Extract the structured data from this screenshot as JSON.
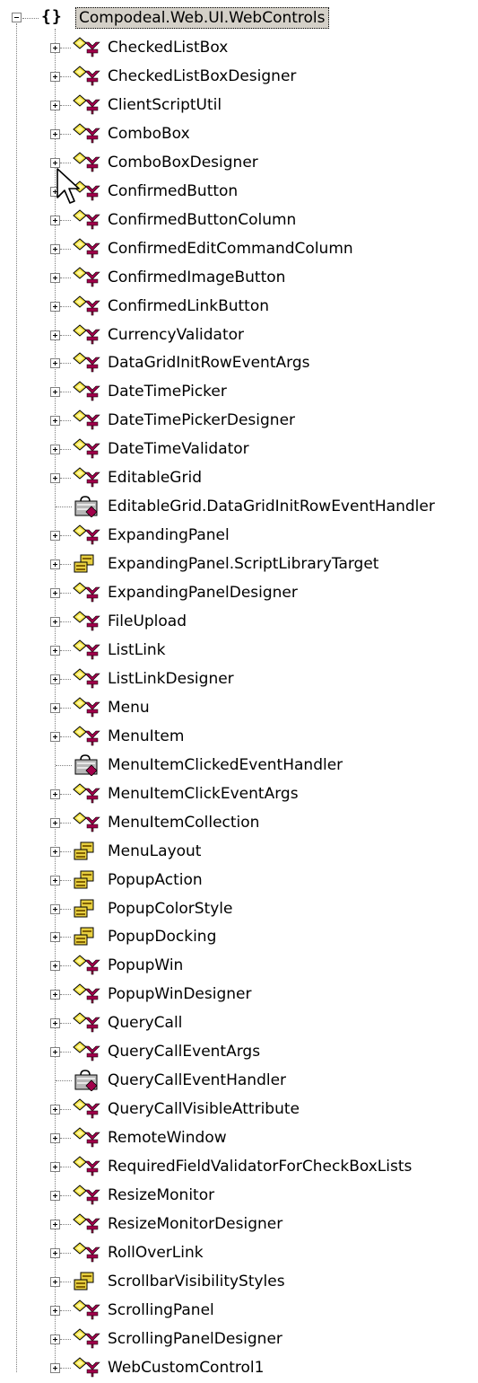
{
  "root": {
    "label": "Compodeal.Web.UI.WebControls",
    "icon": "namespace-icon",
    "glyph": "{}",
    "expanded": true
  },
  "items": [
    {
      "label": "CheckedListBox",
      "kind": "class"
    },
    {
      "label": "CheckedListBoxDesigner",
      "kind": "class"
    },
    {
      "label": "ClientScriptUtil",
      "kind": "class"
    },
    {
      "label": "ComboBox",
      "kind": "class"
    },
    {
      "label": "ComboBoxDesigner",
      "kind": "class"
    },
    {
      "label": "ConfirmedButton",
      "kind": "class"
    },
    {
      "label": "ConfirmedButtonColumn",
      "kind": "class"
    },
    {
      "label": "ConfirmedEditCommandColumn",
      "kind": "class"
    },
    {
      "label": "ConfirmedImageButton",
      "kind": "class"
    },
    {
      "label": "ConfirmedLinkButton",
      "kind": "class"
    },
    {
      "label": "CurrencyValidator",
      "kind": "class"
    },
    {
      "label": "DataGridInitRowEventArgs",
      "kind": "class"
    },
    {
      "label": "DateTimePicker",
      "kind": "class"
    },
    {
      "label": "DateTimePickerDesigner",
      "kind": "class"
    },
    {
      "label": "DateTimeValidator",
      "kind": "class"
    },
    {
      "label": "EditableGrid",
      "kind": "class"
    },
    {
      "label": "EditableGrid.DataGridInitRowEventHandler",
      "kind": "delegate"
    },
    {
      "label": "ExpandingPanel",
      "kind": "class"
    },
    {
      "label": "ExpandingPanel.ScriptLibraryTarget",
      "kind": "enum"
    },
    {
      "label": "ExpandingPanelDesigner",
      "kind": "class"
    },
    {
      "label": "FileUpload",
      "kind": "class"
    },
    {
      "label": "ListLink",
      "kind": "class"
    },
    {
      "label": "ListLinkDesigner",
      "kind": "class"
    },
    {
      "label": "Menu",
      "kind": "class"
    },
    {
      "label": "MenuItem",
      "kind": "class"
    },
    {
      "label": "MenuItemClickedEventHandler",
      "kind": "delegate"
    },
    {
      "label": "MenuItemClickEventArgs",
      "kind": "class"
    },
    {
      "label": "MenuItemCollection",
      "kind": "class"
    },
    {
      "label": "MenuLayout",
      "kind": "enum"
    },
    {
      "label": "PopupAction",
      "kind": "enum"
    },
    {
      "label": "PopupColorStyle",
      "kind": "enum"
    },
    {
      "label": "PopupDocking",
      "kind": "enum"
    },
    {
      "label": "PopupWin",
      "kind": "class"
    },
    {
      "label": "PopupWinDesigner",
      "kind": "class"
    },
    {
      "label": "QueryCall",
      "kind": "class"
    },
    {
      "label": "QueryCallEventArgs",
      "kind": "class"
    },
    {
      "label": "QueryCallEventHandler",
      "kind": "delegate"
    },
    {
      "label": "QueryCallVisibleAttribute",
      "kind": "class"
    },
    {
      "label": "RemoteWindow",
      "kind": "class"
    },
    {
      "label": "RequiredFieldValidatorForCheckBoxLists",
      "kind": "class"
    },
    {
      "label": "ResizeMonitor",
      "kind": "class"
    },
    {
      "label": "ResizeMonitorDesigner",
      "kind": "class"
    },
    {
      "label": "RollOverLink",
      "kind": "class"
    },
    {
      "label": "ScrollbarVisibilityStyles",
      "kind": "enum"
    },
    {
      "label": "ScrollingPanel",
      "kind": "class"
    },
    {
      "label": "ScrollingPanelDesigner",
      "kind": "class"
    },
    {
      "label": "WebCustomControl1",
      "kind": "class"
    }
  ],
  "icons": {
    "class": "class-icon",
    "delegate": "delegate-icon",
    "enum": "enum-icon",
    "mouse_cursor": "mouse-pointer-icon"
  },
  "colors": {
    "selection_background": "#d4d0c8",
    "tree_lines": "#808080",
    "class_icon_yellow": "#f0e040",
    "class_icon_magenta": "#a0004a",
    "delegate_icon_gray": "#b8b8b8",
    "enum_icon_yellow": "#e8d040"
  }
}
